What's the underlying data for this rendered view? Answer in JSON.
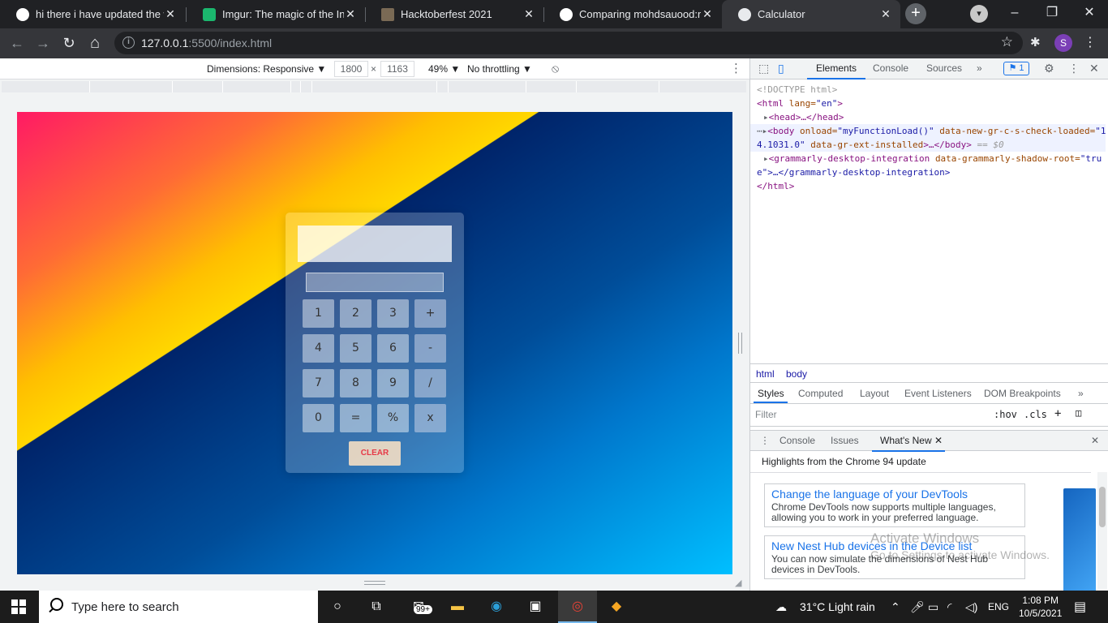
{
  "tabs": [
    {
      "title": "hi there i have updated the w",
      "favicon": "github-icon",
      "color": "#ffffff"
    },
    {
      "title": "Imgur: The magic of the Inter",
      "favicon": "imgur-icon",
      "color": "#1bb76e"
    },
    {
      "title": "Hacktoberfest 2021",
      "favicon": "hacktoberfest-icon",
      "color": "#7a6a55"
    },
    {
      "title": "Comparing mohdsauood:ma",
      "favicon": "github-icon",
      "color": "#ffffff"
    },
    {
      "title": "Calculator",
      "favicon": "globe-icon",
      "color": "#e8eaed"
    }
  ],
  "tab_close": "✕",
  "new_tab": "+",
  "window": {
    "minimize": "–",
    "maximize": "❐",
    "close": "✕"
  },
  "toolbar": {
    "back": "←",
    "forward": "→",
    "reload": "↻",
    "home": "⌂",
    "url_host": "127.0.0.1",
    "url_path": ":5500/index.html",
    "info": "i",
    "star": "☆",
    "extensions": "✱",
    "profile": "S",
    "menu": "⋮"
  },
  "device_toolbar": {
    "dimensions_label": "Dimensions: Responsive ▼",
    "width": "1800",
    "times": "×",
    "height": "1163",
    "zoom": "49% ▼",
    "throttle": "No throttling ▼",
    "rotate": "⃠",
    "more": "⋮"
  },
  "calculator": {
    "keys": [
      "1",
      "2",
      "3",
      "+",
      "4",
      "5",
      "6",
      "-",
      "7",
      "8",
      "9",
      "/",
      "0",
      "=",
      "%",
      "x"
    ],
    "clear": "CLEAR"
  },
  "devtools": {
    "tabs": [
      "Elements",
      "Console",
      "Sources",
      "»"
    ],
    "issues_badge": "1",
    "dom": {
      "doctype": "<!DOCTYPE html>",
      "html_open_tag": "<html ",
      "html_lang_attr": "lang=",
      "html_lang_val": "\"en\"",
      "html_open_end": ">",
      "head": "<head>…</head>",
      "body_tag": "<body ",
      "body_onload_attr": "onload=",
      "body_onload_val": "\"myFunctionLoad()\"",
      "body_attr2": " data-new-gr-c-s-check-loaded=",
      "body_attr2_val": "\"1",
      "body_line2_val": "4.1031.0\"",
      "body_attr3": " data-gr-ext-installed",
      "body_close": ">…</body>",
      "body_eq": " == $0",
      "gram_tag": "<grammarly-desktop-integration ",
      "gram_attr": "data-grammarly-shadow-root=",
      "gram_val": "\"tru",
      "gram_line2": "e\">…</grammarly-desktop-integration>",
      "html_close": "</html>"
    },
    "breadcrumbs": [
      "html",
      "body"
    ],
    "style_tabs": [
      "Styles",
      "Computed",
      "Layout",
      "Event Listeners",
      "DOM Breakpoints",
      "»"
    ],
    "filter_placeholder": "Filter",
    "filter_buttons": [
      ":hov",
      ".cls",
      "+"
    ],
    "drawer_tabs": [
      "Console",
      "Issues",
      "What's New"
    ],
    "drawer_close": "✕",
    "highlights": "Highlights from the Chrome 94 update",
    "cards": [
      {
        "title": "Change the language of your DevTools",
        "desc": "Chrome DevTools now supports multiple languages, allowing you to work in your preferred language."
      },
      {
        "title": "New Nest Hub devices in the Device list",
        "desc": "You can now simulate the dimensions of Nest Hub devices in DevTools."
      }
    ],
    "watermark_title": "Activate Windows",
    "watermark_sub": "Go to Settings to activate Windows."
  },
  "taskbar": {
    "search_placeholder": "Type here to search",
    "mail_badge": "99+",
    "weather": "31°C  Light rain",
    "lang": "ENG",
    "time": "1:08 PM",
    "date": "10/5/2021"
  }
}
